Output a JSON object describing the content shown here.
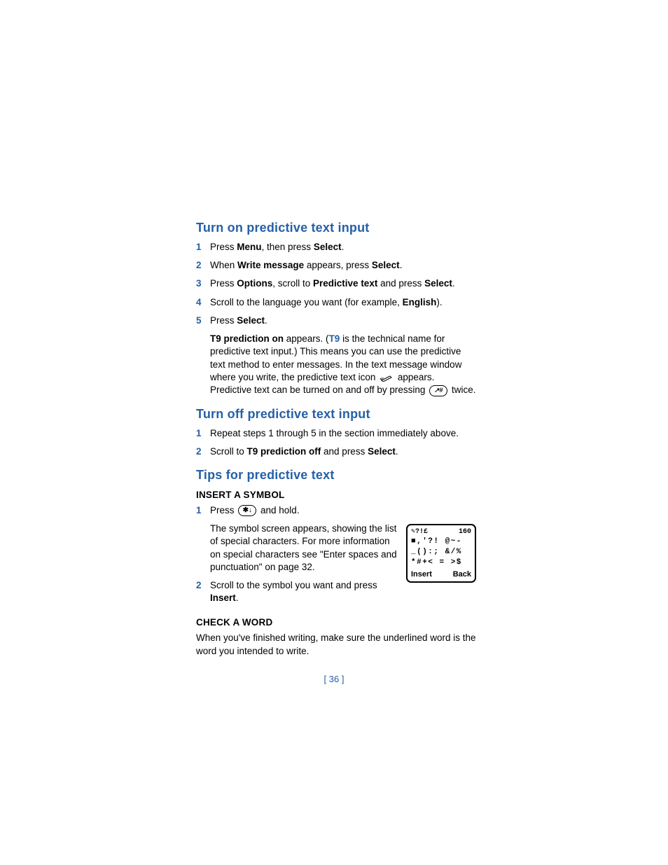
{
  "sections": {
    "turn_on": {
      "heading": "Turn on predictive text input",
      "steps": [
        {
          "n": "1",
          "parts": [
            "Press ",
            {
              "b": "Menu"
            },
            ", then press ",
            {
              "b": "Select"
            },
            "."
          ]
        },
        {
          "n": "2",
          "parts": [
            "When ",
            {
              "b": "Write message"
            },
            " appears, press ",
            {
              "b": "Select"
            },
            "."
          ]
        },
        {
          "n": "3",
          "parts": [
            "Press ",
            {
              "b": "Options"
            },
            ", scroll to ",
            {
              "b": "Predictive text"
            },
            " and press ",
            {
              "b": "Select"
            },
            "."
          ]
        },
        {
          "n": "4",
          "parts": [
            "Scroll to the language you want (for example, ",
            {
              "b": "English"
            },
            ")."
          ]
        },
        {
          "n": "5",
          "parts": [
            "Press ",
            {
              "b": "Select"
            },
            "."
          ]
        }
      ],
      "note_pre_bold": "T9 prediction on",
      "note_mid1": " appears. (",
      "note_t9": "T9",
      "note_mid2": " is the technical name for predictive text input.) This means you can use the predictive text method to enter messages. In the text message window where you write, the predictive text icon ",
      "note_after_icon": " appears. Predictive text can be turned on and off by pressing ",
      "note_end": " twice."
    },
    "turn_off": {
      "heading": "Turn off predictive text input",
      "steps": [
        {
          "n": "1",
          "parts": [
            "Repeat steps 1 through 5 in the section immediately above."
          ]
        },
        {
          "n": "2",
          "parts": [
            "Scroll to ",
            {
              "b": "T9 prediction off"
            },
            " and press ",
            {
              "b": "Select"
            },
            "."
          ]
        }
      ]
    },
    "tips": {
      "heading": "Tips for predictive text",
      "insert_symbol_sub": "INSERT A SYMBOL",
      "insert_steps": [
        {
          "n": "1",
          "pre": "Press ",
          "post": " and hold."
        },
        {
          "n": "2",
          "parts": [
            "Scroll to the symbol you want and press ",
            {
              "b": "Insert"
            },
            "."
          ]
        }
      ],
      "insert_note": "The symbol screen appears, showing the list of special characters. For more information on special characters see \"Enter spaces and punctuation\" on page 32.",
      "check_word_sub": "CHECK A WORD",
      "check_word_body": "When you've finished writing, make sure the underlined word is the word you intended to write."
    }
  },
  "phone_screen": {
    "top_left": "✎?!£",
    "top_right": "160",
    "row1": "■,'?! @~-",
    "row2": "_():; &/%",
    "row3": "*#+< = >$",
    "soft_left": "Insert",
    "soft_right": "Back"
  },
  "icons": {
    "star_key": "✱↓",
    "hash_key": "↗#",
    "pencil": "pencil-icon"
  },
  "page_number": "[ 36 ]"
}
